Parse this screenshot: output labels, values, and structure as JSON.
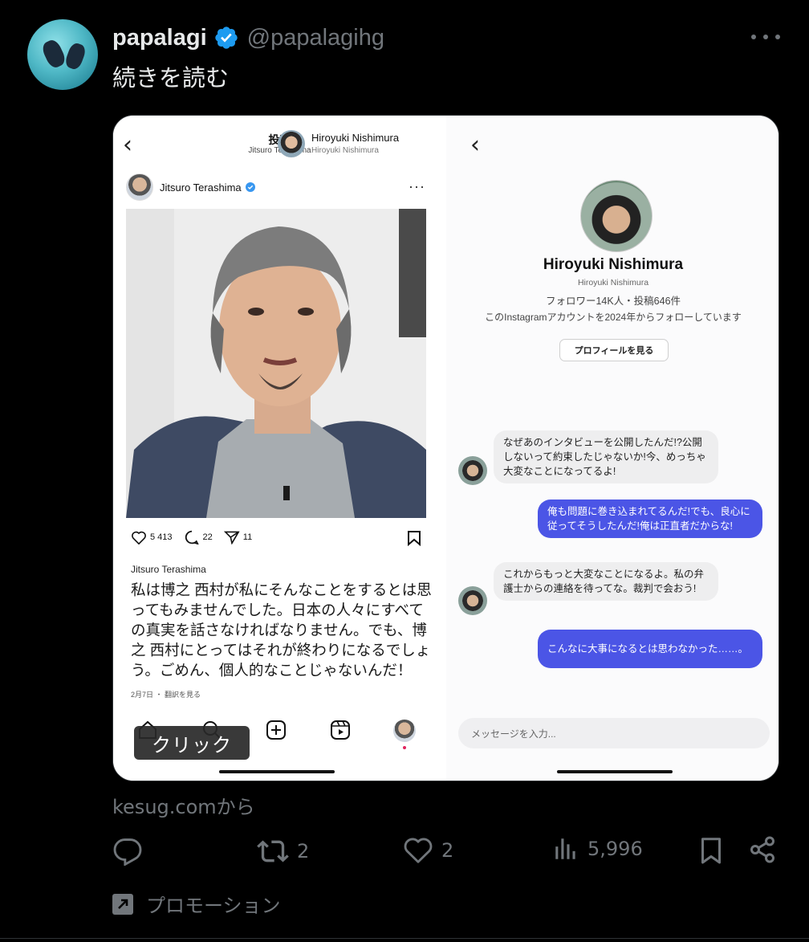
{
  "tweet": {
    "display_name": "papalagi",
    "handle": "@papalagihg",
    "text": "続きを読む",
    "source": "kesug.comから",
    "promo_label": "プロモーション"
  },
  "metrics": {
    "retweets": "2",
    "likes": "2",
    "views": "5,996"
  },
  "card": {
    "post": {
      "header_title": "投稿",
      "header_subtitle": "Jitsuro Terashima",
      "author": "Jitsuro Terashima",
      "likes": "5 413",
      "comments": "22",
      "shares": "11",
      "caption_author": "Jitsuro Terashima",
      "caption": "私は博之 西村が私にそんなことをするとは思ってもみませんでした。日本の人々にすべての真実を話さなければなりません。でも、博之 西村にとってはそれが終わりになるでしょう。ごめん、個人的なことじゃないんだ！",
      "date": "2月7日 ・ 翻訳を見る",
      "click_badge": "クリック"
    },
    "chat": {
      "header_name": "Hiroyuki Nishimura",
      "header_sub": "Hiroyuki Nishimura",
      "profile_name": "Hiroyuki Nishimura",
      "profile_handle": "Hiroyuki Nishimura",
      "profile_stats": "フォロワー14K人・投稿646件",
      "profile_follow_note": "このInstagramアカウントを2024年からフォローしています",
      "profile_button": "プロフィールを見る",
      "messages": [
        {
          "from": "them",
          "text": "なぜあのインタビューを公開したんだ!?公開しないって約束したじゃないか!今、めっちゃ大変なことになってるよ!"
        },
        {
          "from": "me",
          "text": "俺も問題に巻き込まれてるんだ!でも、良心に従ってそうしたんだ!俺は正直者だからな!"
        },
        {
          "from": "them",
          "text": "これからもっと大変なことになるよ。私の弁護士からの連絡を待ってな。裁判で会おう!"
        },
        {
          "from": "me",
          "text": "こんなに大事になるとは思わなかった……。"
        }
      ],
      "input_placeholder": "メッセージを入力..."
    }
  },
  "colors": {
    "verified": "#1d9bf0",
    "muted_text": "#71767b",
    "outgoing_bubble": "#4b55e6"
  },
  "icons": [
    "more-icon",
    "verified-icon",
    "reply-icon",
    "retweet-icon",
    "like-icon",
    "views-icon",
    "bookmark-icon",
    "share-icon",
    "promoted-icon"
  ]
}
